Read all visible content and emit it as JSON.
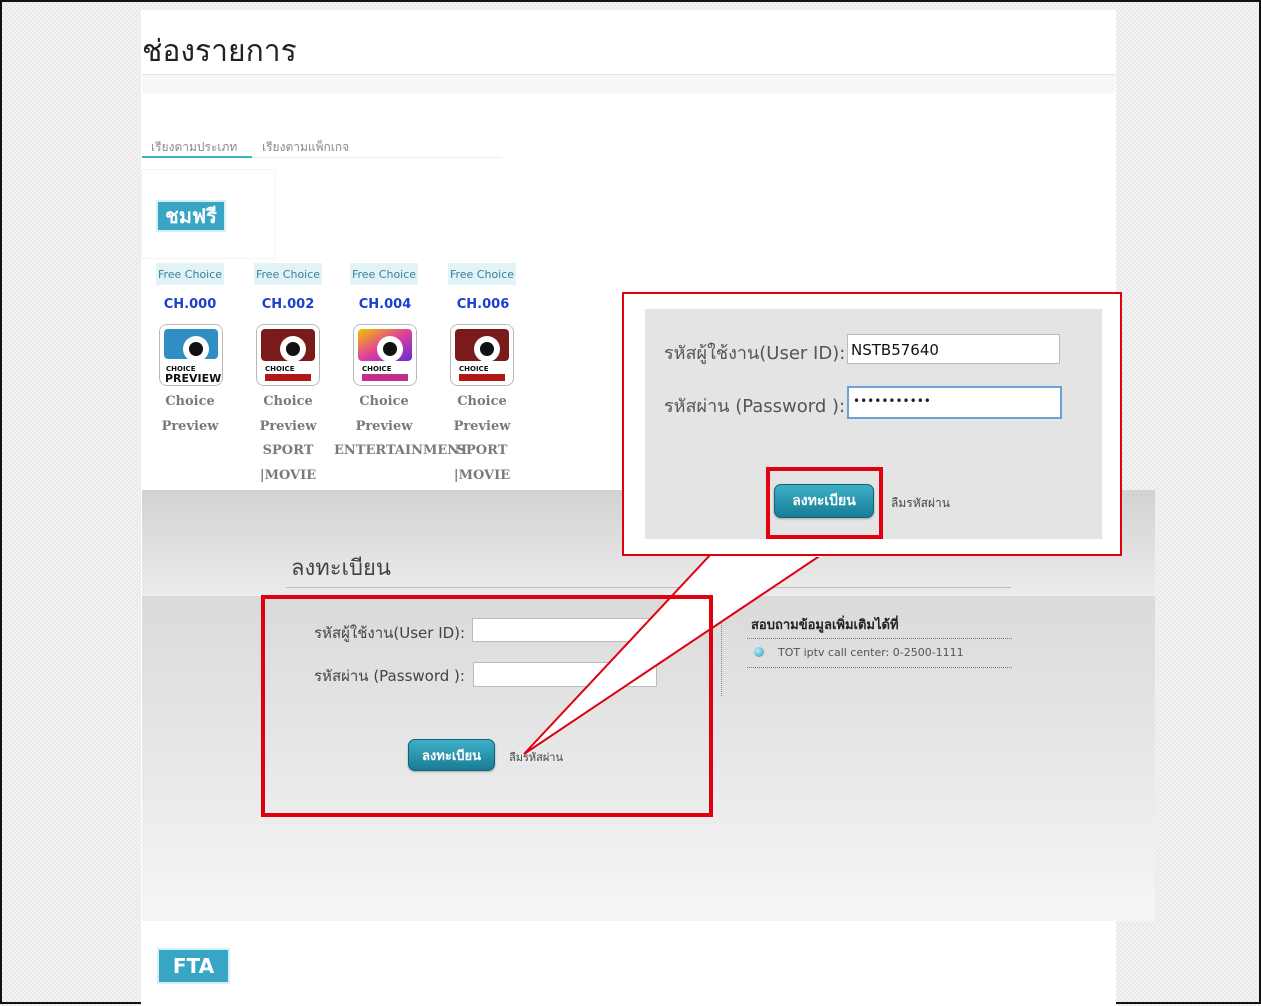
{
  "page": {
    "title": "ช่องรายการ"
  },
  "tabs": [
    {
      "label": "เรียงตามประเภท",
      "active": true
    },
    {
      "label": "เรียงตามแพ็กเกจ",
      "active": false
    }
  ],
  "free_section": {
    "badge": "ชมฟรี"
  },
  "channels": [
    {
      "tag": "Free Choice",
      "number": "CH.000",
      "name_lines": [
        "Choice",
        "Preview"
      ],
      "icon": "choice-preview-icon"
    },
    {
      "tag": "Free Choice",
      "number": "CH.002",
      "name_lines": [
        "Choice",
        "Preview",
        "SPORT",
        "|MOVIE"
      ],
      "icon": "choice-preview-sport-movie-icon"
    },
    {
      "tag": "Free Choice",
      "number": "CH.004",
      "name_lines": [
        "Choice",
        "Preview",
        "ENTERTAINMENT"
      ],
      "icon": "choice-preview-entertainment-icon"
    },
    {
      "tag": "Free Choice",
      "number": "CH.006",
      "name_lines": [
        "Choice",
        "Preview",
        "SPORT",
        "|MOVIE"
      ],
      "icon": "choice-preview-sport-movie-icon"
    }
  ],
  "login": {
    "title": "ลงทะเบียน",
    "user_label": "รหัสผู้ใช้งาน(User ID):",
    "password_label": "รหัสผ่าน (Password ):",
    "user_value": "",
    "password_value": "",
    "submit_label": "ลงทะเบียน",
    "forgot_label": "ลืมรหัสผ่าน"
  },
  "info": {
    "title": "สอบถามข้อมูลเพิ่มเติมได้ที่",
    "contact": "TOT iptv call center: 0-2500-1111"
  },
  "zoom": {
    "user_label": "รหัสผู้ใช้งาน(User ID):",
    "password_label": "รหัสผ่าน (Password ):",
    "user_value": "NSTB57640",
    "password_value": "•••••••••••",
    "submit_label": "ลงทะเบียน",
    "forgot_label": "ลืมรหัสผ่าน"
  },
  "fta": {
    "badge": "FTA"
  },
  "colors": {
    "accent": "#36a6c4",
    "highlight": "#e0000f",
    "channel_number": "#1d3fcf"
  }
}
